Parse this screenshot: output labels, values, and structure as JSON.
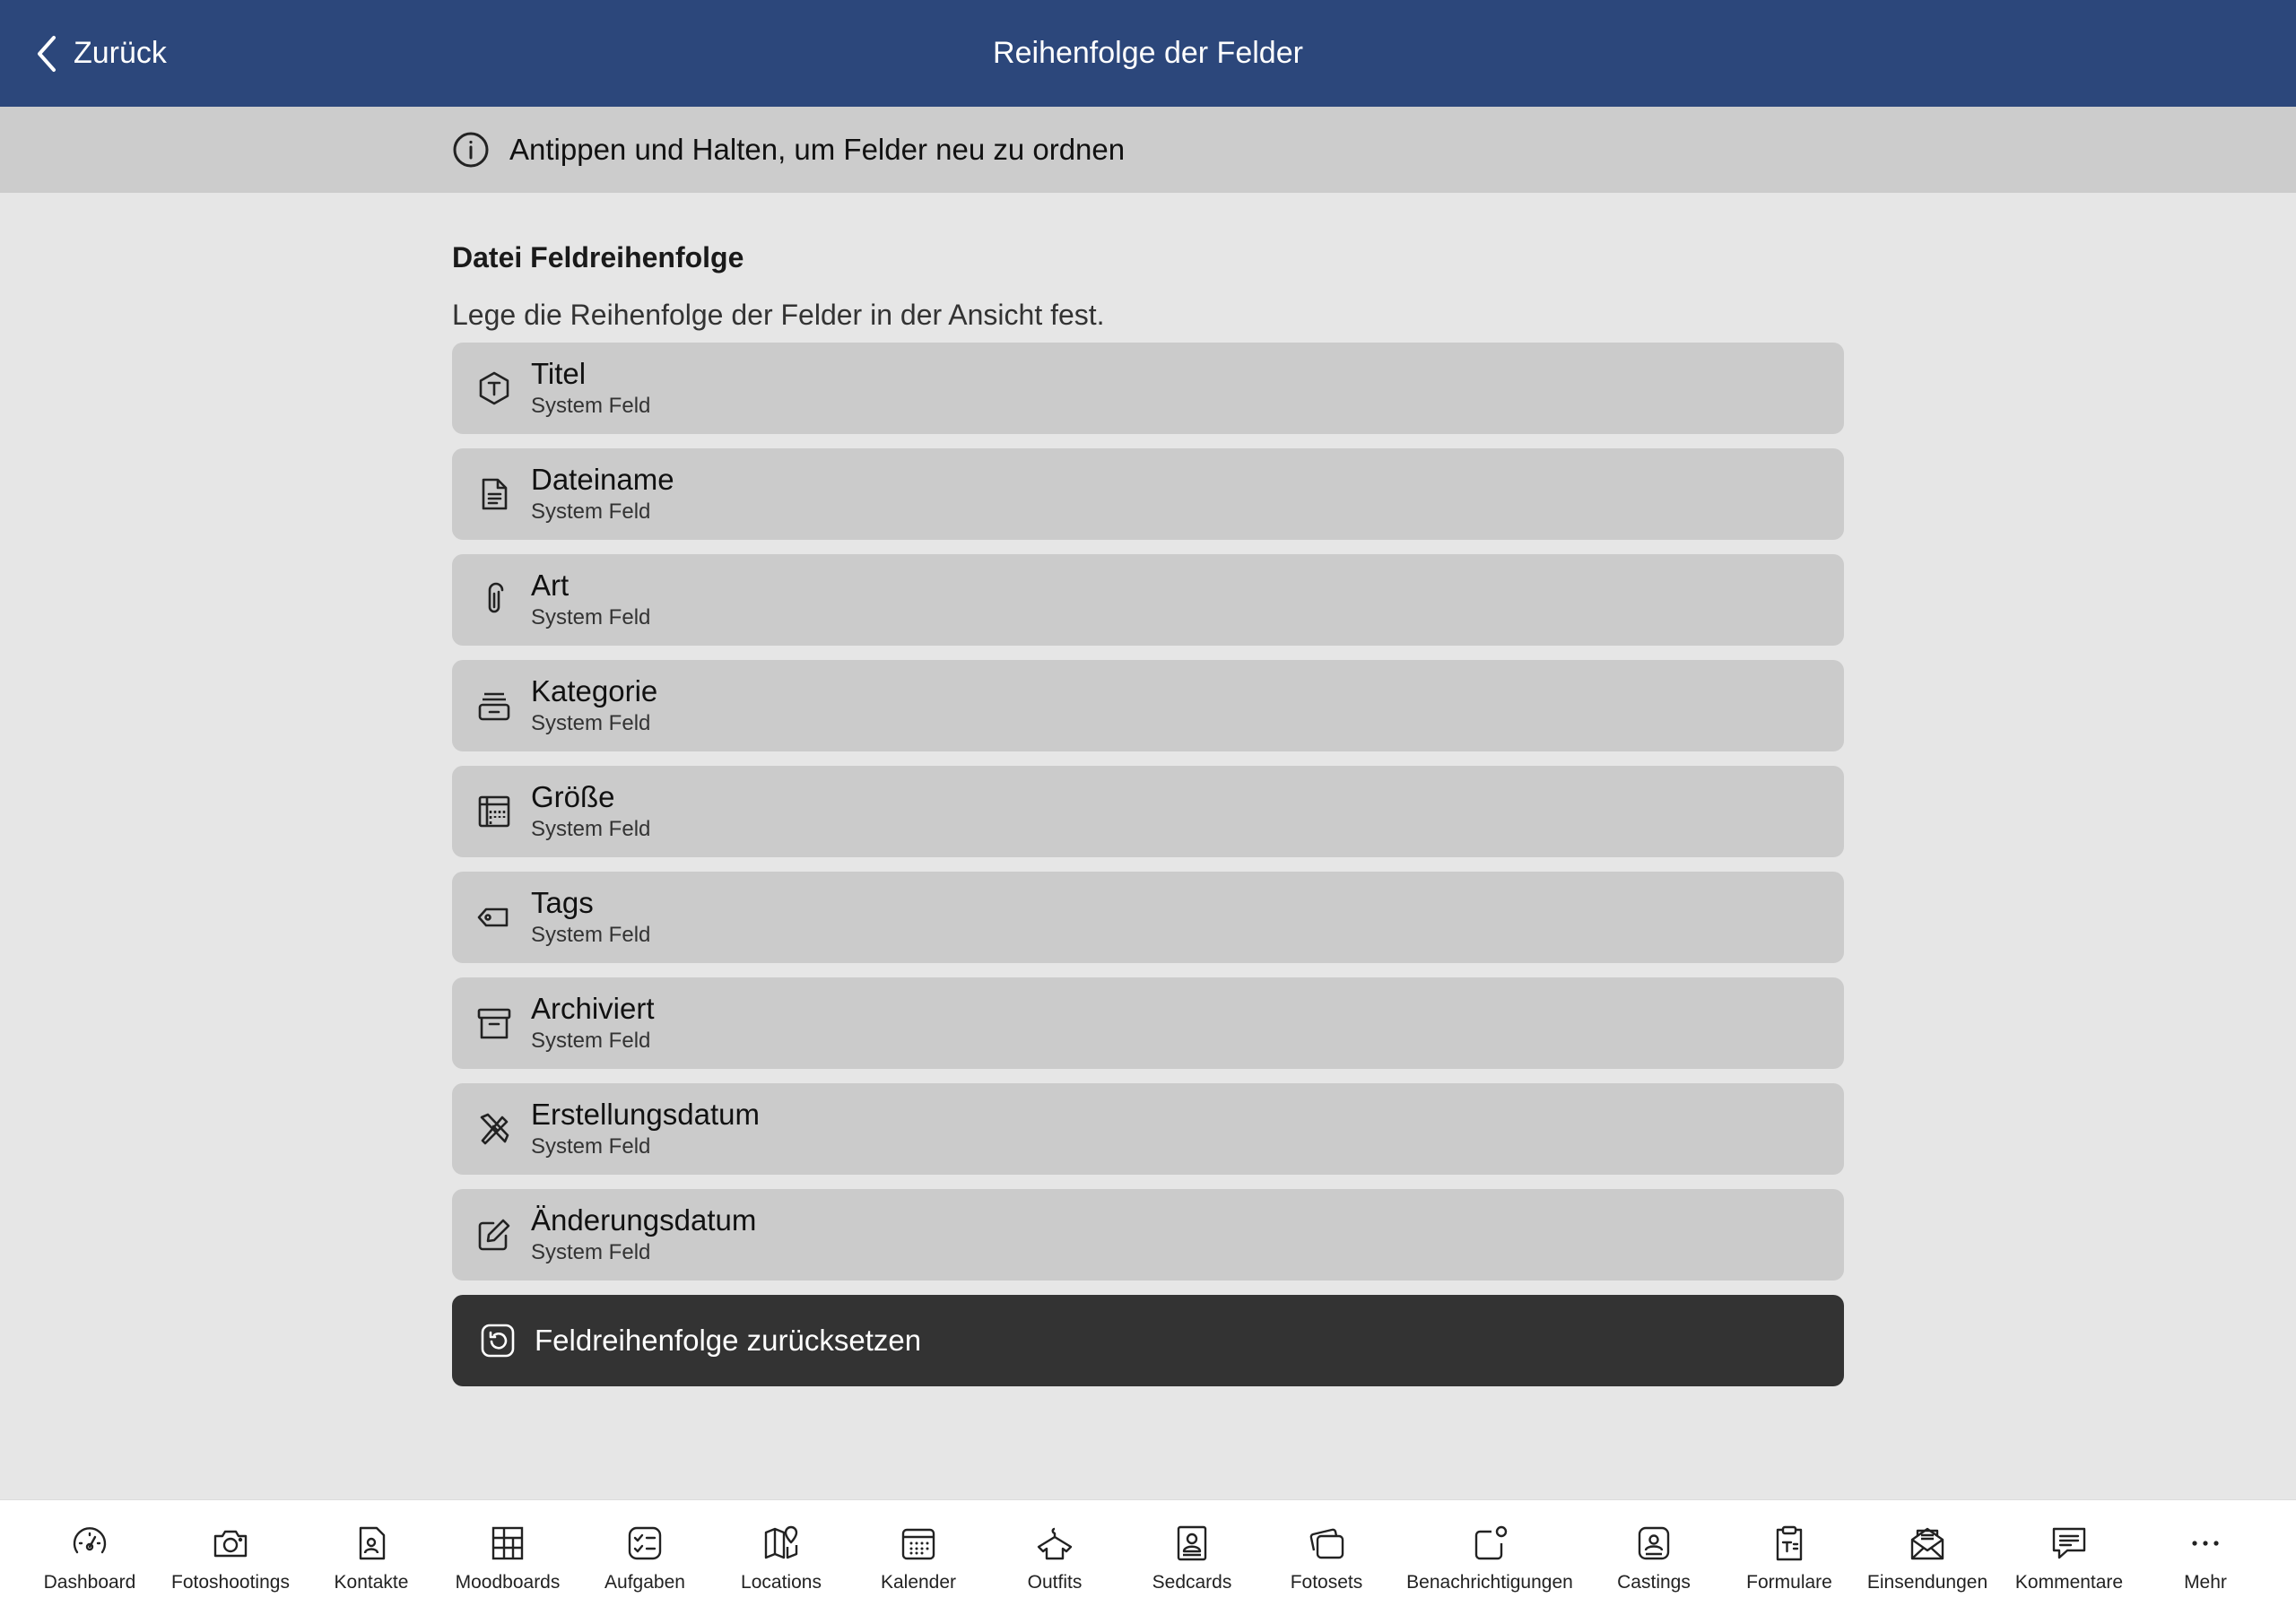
{
  "header": {
    "back_label": "Zurück",
    "title": "Reihenfolge der Felder"
  },
  "info": {
    "text": "Antippen und Halten, um Felder neu zu ordnen"
  },
  "section": {
    "title": "Datei Feldreihenfolge",
    "description": "Lege die Reihenfolge der Felder in der Ansicht fest."
  },
  "fields": [
    {
      "label": "Titel",
      "sub": "System Feld",
      "icon": "title-hexagon-icon"
    },
    {
      "label": "Dateiname",
      "sub": "System Feld",
      "icon": "document-icon"
    },
    {
      "label": "Art",
      "sub": "System Feld",
      "icon": "paperclip-icon"
    },
    {
      "label": "Kategorie",
      "sub": "System Feld",
      "icon": "tray-icon"
    },
    {
      "label": "Größe",
      "sub": "System Feld",
      "icon": "ruler-icon"
    },
    {
      "label": "Tags",
      "sub": "System Feld",
      "icon": "tag-icon"
    },
    {
      "label": "Archiviert",
      "sub": "System Feld",
      "icon": "archive-box-icon"
    },
    {
      "label": "Erstellungsdatum",
      "sub": "System Feld",
      "icon": "tools-icon"
    },
    {
      "label": "Änderungsdatum",
      "sub": "System Feld",
      "icon": "edit-icon"
    }
  ],
  "reset_button": {
    "label": "Feldreihenfolge zurücksetzen",
    "icon": "reset-icon"
  },
  "tabbar": [
    {
      "label": "Dashboard",
      "icon": "gauge-icon"
    },
    {
      "label": "Fotoshootings",
      "icon": "camera-icon"
    },
    {
      "label": "Kontakte",
      "icon": "contact-icon"
    },
    {
      "label": "Moodboards",
      "icon": "grid-board-icon"
    },
    {
      "label": "Aufgaben",
      "icon": "checklist-icon"
    },
    {
      "label": "Locations",
      "icon": "map-pin-icon"
    },
    {
      "label": "Kalender",
      "icon": "calendar-icon"
    },
    {
      "label": "Outfits",
      "icon": "shirt-icon"
    },
    {
      "label": "Sedcards",
      "icon": "sedcard-icon"
    },
    {
      "label": "Fotosets",
      "icon": "photosets-icon"
    },
    {
      "label": "Benachrichtigungen",
      "icon": "notification-icon"
    },
    {
      "label": "Castings",
      "icon": "casting-icon"
    },
    {
      "label": "Formulare",
      "icon": "clipboard-icon"
    },
    {
      "label": "Einsendungen",
      "icon": "mail-icon"
    },
    {
      "label": "Kommentare",
      "icon": "comment-icon"
    },
    {
      "label": "Mehr",
      "icon": "more-icon"
    }
  ]
}
